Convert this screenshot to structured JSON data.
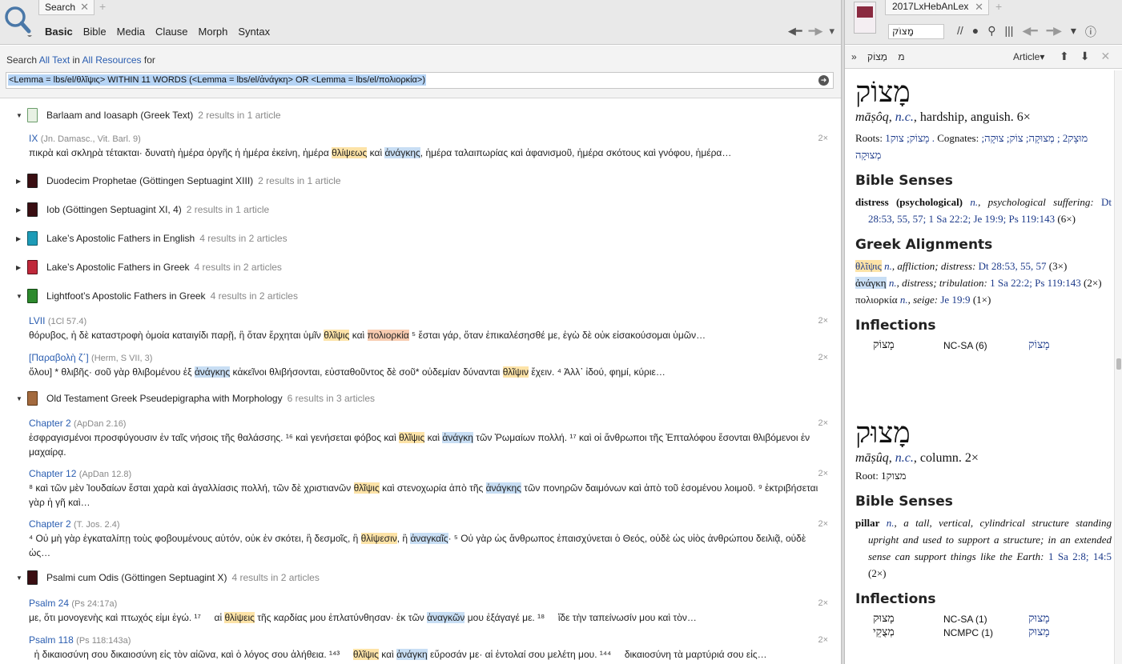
{
  "left": {
    "tab_label": "Search",
    "nav": [
      "Basic",
      "Bible",
      "Media",
      "Clause",
      "Morph",
      "Syntax"
    ],
    "search_prefix": "Search",
    "scope_text": "All Text",
    "in_word": "in",
    "scope_resources": "All Resources",
    "for_word": "for",
    "query": "<Lemma = lbs/el/θλῖψις> WITHIN 11 WORDS (<Lemma = lbs/el/ἀνάγκη> OR <Lemma = lbs/el/πολιορκία>)",
    "results": [
      {
        "name": "Barlaam and Ioasaph (Greek Text)",
        "count": "2 results in 1 article",
        "expanded": true,
        "color": "#e8f1e4"
      },
      {
        "name": "Duodecim Prophetae (Göttingen Septuagint XIII)",
        "count": "2 results in 1 article",
        "expanded": false,
        "color": "#3a0e12"
      },
      {
        "name": "Iob (Göttingen Septuagint XI, 4)",
        "count": "2 results in 1 article",
        "expanded": false,
        "color": "#3a0e12"
      },
      {
        "name": "Lake’s Apostolic Fathers in English",
        "count": "4 results in 2 articles",
        "expanded": false,
        "color": "#1d9bb7"
      },
      {
        "name": "Lake’s Apostolic Fathers in Greek",
        "count": "4 results in 2 articles",
        "expanded": false,
        "color": "#c0283a"
      },
      {
        "name": "Lightfoot’s Apostolic Fathers in Greek",
        "count": "4 results in 2 articles",
        "expanded": true,
        "color": "#2d8a2d"
      },
      {
        "name": "Old Testament Greek Pseudepigrapha with Morphology",
        "count": "6 results in 3 articles",
        "expanded": true,
        "color": "#a36a3e"
      },
      {
        "name": "Psalmi cum Odis (Göttingen Septuagint X)",
        "count": "4 results in 2 articles",
        "expanded": true,
        "color": "#3a0e12"
      }
    ],
    "hits": {
      "h1": {
        "ref": "IX",
        "sub": "(Jn. Damasc., Vit. Barl. 9)",
        "cnt": "2×",
        "t1": "πικρὰ καὶ σκληρὰ τέτακται· δυνατὴ ἡμέρα ὀργῆς ἡ ἡμέρα ἐκείνη, ἡμέρα ",
        "k1": "θλίψεως",
        "t2": " καὶ ",
        "k2": "ἀνάγκης",
        "t3": ", ἡμέρα ταλαιπωρίας καὶ ἀφανισμοῦ, ἡμέρα σκότους καὶ γνόφου, ἡμέρα…"
      },
      "h2": {
        "ref": "LVII",
        "sub": "(1Cl 57.4)",
        "cnt": "2×",
        "t1": "θόρυβος, ἡ δὲ καταστροφὴ ὁμοία καταιγίδι παρῇ, ἢ ὅταν ἔρχηται ὑμῖν ",
        "k1": "θλῖψις",
        "t2": " καὶ ",
        "k2": "πολιορκία",
        "t3": " ⁵ ἔσται γάρ, ὅταν ἐπικαλέσησθέ με, ἐγὼ δὲ οὐκ εἰσακούσομαι ὑμῶν…"
      },
      "h3": {
        "ref": "[Παραβολὴ ζ΄]",
        "sub": "(Herm, S VII, 3)",
        "cnt": "2×",
        "t1": "ὅλου] * θλιβῆς· σοῦ γὰρ θλιβομένου ἐξ ",
        "k1": "ἀνάγκης",
        "t2": " κἀκεῖνοι θλιβήσονται, εὐσταθοῦντος δὲ σοῦ* οὐδεμίαν δύνανται ",
        "k2": "θλῖψιν",
        "t3": " ἔχειν. ⁴ Ἀλλ᾽ ἰδού, φημί, κύριε…"
      },
      "h4": {
        "ref": "Chapter 2",
        "sub": "(ApDan 2.16)",
        "cnt": "2×",
        "t1": "ἐσφραγισμένοι προσφύγουσιν ἐν ταῖς νήσοις τῆς θαλάσσης. ¹⁶ καὶ γενήσεται φόβος καὶ ",
        "k1": "θλῖψις",
        "t2": " καὶ ",
        "k2": "ἀνάγκη",
        "t3": " τῶν Ῥωμαίων πολλή. ¹⁷ καὶ οἱ ἄνθρωποι τῆς Ἑπταλόφου ἔσονται θλιβόμενοι ἐν μαχαίρᾳ."
      },
      "h5": {
        "ref": "Chapter 12",
        "sub": "(ApDan 12.8)",
        "cnt": "2×",
        "t1": "⁸ καὶ τῶν μὲν Ἰουδαίων ἔσται χαρὰ καὶ ἀγαλλίασις πολλή, τῶν δὲ χριστιανῶν ",
        "k1": "θλῖψις",
        "t2": " καὶ στενοχωρία ἀπὸ τῆς ",
        "k2": "ἀνάγκης",
        "t3": " τῶν πονηρῶν δαιμόνων καὶ ἀπὸ τοῦ ἐσομένου λοιμοῦ. ⁹ ἐκτριβήσεται γὰρ ἡ γῆ καὶ…"
      },
      "h6": {
        "ref": "Chapter 2",
        "sub": "(T. Jos. 2.4)",
        "cnt": "2×",
        "t1": "⁴ Οὐ μὴ γὰρ ἐγκαταλίπῃ τοὺς φοβουμένους αὐτόν, οὐκ ἐν σκότει, ἢ δεσμοῖς, ἢ ",
        "k1": "θλίψεσιν",
        "t2": ", ἢ ",
        "k2": "ἀναγκαῖς",
        "t3": "· ⁵ Οὐ γὰρ ὡς ἄνθρωπος ἐπαισχύνεται ὁ Θεός, οὐδὲ ὡς υἱὸς ἀνθρώπου δειλιᾷ, οὐδὲ ὡς…"
      },
      "h7": {
        "ref": "Psalm 24",
        "sub": "(Ps 24:17a)",
        "cnt": "2×",
        "t1": "με, ὅτι μονογενὴς καὶ πτωχός εἰμι ἐγώ. ¹⁷     αἱ ",
        "k1": "θλίψεις",
        "t2": " τῆς καρδίας μου ἐπλατύνθησαν· ἐκ τῶν ",
        "k2": "ἀναγκῶν",
        "t3": " μου ἐξάγαγέ με. ¹⁸     ἴδε τὴν ταπείνωσίν μου καὶ τὸν…"
      },
      "h8": {
        "ref": "Psalm 118",
        "sub": "(Ps 118:143a)",
        "cnt": "2×",
        "t1": "  ἡ δικαιοσύνη σου δικαιοσύνη εἰς τὸν αἰῶνα, καὶ ὁ λόγος σου ἀλήθεια. ¹⁴³     ",
        "k1": "θλῖψις",
        "t2": " καὶ ",
        "k2": "ἀνάγκη",
        "t3": " εὕροσάν με· αἱ ἐντολαί σου μελέτη μου. ¹⁴⁴     δικαιοσύνη τὰ μαρτύριά σου εἰς…"
      }
    }
  },
  "right": {
    "tab_label": "2017LxHebAnLex",
    "input_value": "מָצוֹק",
    "breadcrumb": [
      "»",
      "מ",
      "מָצוֹק"
    ],
    "article_label": "Article",
    "e1": {
      "head": "מָצוֹק",
      "translit": "māṣôq",
      "pos": "n.c.",
      "gloss": ", hardship, anguish. 6×",
      "roots_label": "Roots:",
      "roots": "מָצוֹק; צוק1 .",
      "cognates_label": "Cognates:",
      "cognates": "מוּצָק2 ; מְצוּקָה; צוֹק; צוּקָה; מְצוּקָה",
      "bible_senses": "Bible Senses",
      "sense": "distress (psychological)",
      "sense_pos": "n.",
      "sense_def": ", psychological suffering:",
      "sense_refs": "Dt 28:53, 55, 57; 1 Sa 22:2; Je 19:9; Ps 119:143",
      "sense_cnt": " (6×)",
      "greek_title": "Greek Alignments",
      "g1_word": "θλῖψις",
      "g1_pos": " n.",
      "g1_def": ", affliction; distress: ",
      "g1_refs": "Dt 28:53, 55, 57",
      "g1_cnt": " (3×)",
      "g2_word": "ἀνάγκη",
      "g2_pos": " n.",
      "g2_def": ", distress; tribulation: ",
      "g2_refs": "1 Sa 22:2; Ps 119:143",
      "g2_cnt": " (2×)",
      "g3_word": "πολιορκία",
      "g3_pos": " n.",
      "g3_def": ", seige: ",
      "g3_refs": "Je 19:9",
      "g3_cnt": " (1×)",
      "infl_title": "Inflections",
      "infl": [
        {
          "form": "מָצוֹק",
          "code": "NC-SA (6)",
          "lemma": "מָצוֹק"
        }
      ]
    },
    "e2": {
      "head": "מָצוּק",
      "translit": "māṣûq",
      "pos": "n.c.",
      "gloss": ", column. 2×",
      "roots_label": "Root:",
      "roots": "מצוק1",
      "bible_senses": "Bible Senses",
      "sense": "pillar",
      "sense_pos": "n.",
      "sense_def": ", a tall, vertical, cylindrical structure standing upright and used to support a structure; in an extended sense can support things like the Earth:",
      "sense_refs": "1 Sa 2:8; 14:5",
      "sense_cnt": " (2×)",
      "infl_title": "Inflections",
      "infl": [
        {
          "form": "מָצוּק",
          "code": "NC-SA (1)",
          "lemma": "מָצוּק"
        },
        {
          "form": "מְצֻקֵי",
          "code": "NCMPC (1)",
          "lemma": "מָצוּק"
        }
      ]
    }
  }
}
